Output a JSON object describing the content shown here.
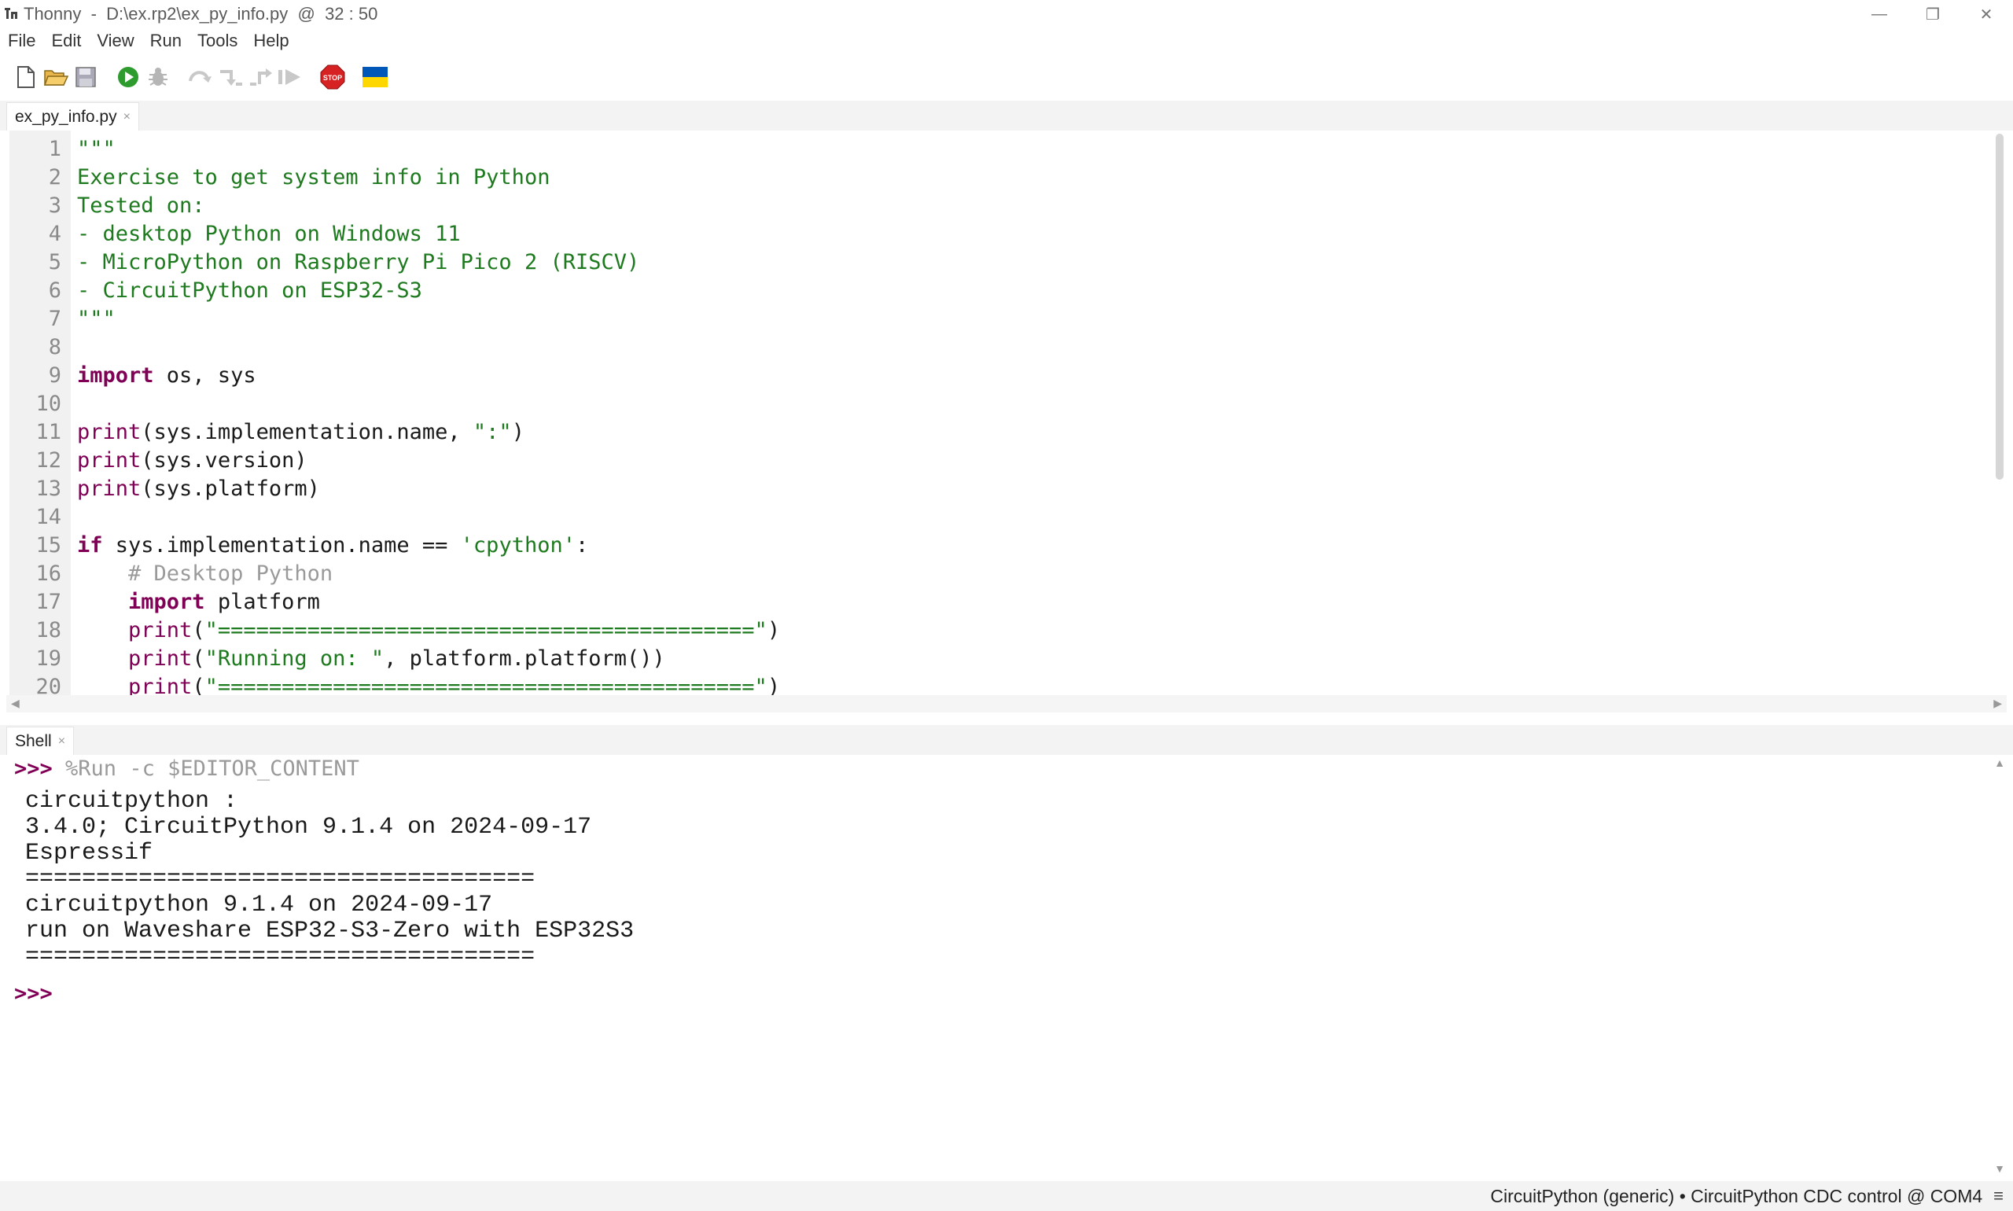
{
  "window": {
    "title": "Thonny  -  D:\\ex.rp2\\ex_py_info.py  @  32 : 50",
    "minimize": "—",
    "maximize": "❐",
    "close": "✕"
  },
  "menu": [
    "File",
    "Edit",
    "View",
    "Run",
    "Tools",
    "Help"
  ],
  "toolbar": {
    "icons": [
      "new-file-icon",
      "open-folder-icon",
      "save-icon",
      "run-icon",
      "debug-icon",
      "step-over-icon",
      "step-into-icon",
      "step-out-icon",
      "resume-icon",
      "stop-icon",
      "ukraine-flag-icon"
    ],
    "colors": {
      "run": "#2e9b2e",
      "stop": "#d62222",
      "flag_blue": "#0057b7",
      "flag_yellow": "#ffd700"
    }
  },
  "editor": {
    "tab_label": "ex_py_info.py",
    "tab_close": "×",
    "line_numbers": [
      "1",
      "2",
      "3",
      "4",
      "5",
      "6",
      "7",
      "8",
      "9",
      "10",
      "11",
      "12",
      "13",
      "14",
      "15",
      "16",
      "17",
      "18",
      "19",
      "20"
    ],
    "lines": [
      "\"\"\"",
      "Exercise to get system info in Python",
      "Tested on:",
      "- desktop Python on Windows 11",
      "- MicroPython on Raspberry Pi Pico 2 (RISCV)",
      "- CircuitPython on ESP32-S3",
      "\"\"\"",
      "",
      "import os, sys",
      "",
      "print(sys.implementation.name, \":\")",
      "print(sys.version)",
      "print(sys.platform)",
      "",
      "if sys.implementation.name == 'cpython':",
      "    # Desktop Python",
      "    import platform",
      "    print(\"==========================================\")",
      "    print(\"Running on: \", platform.platform())",
      "    print(\"==========================================\")"
    ]
  },
  "shell": {
    "tab_label": "Shell",
    "tab_close": "×",
    "prompt": ">>>",
    "command": " %Run -c $EDITOR_CONTENT",
    "output": [
      "circuitpython :",
      "3.4.0; CircuitPython 9.1.4 on 2024-09-17",
      "Espressif",
      "====================================",
      "circuitpython 9.1.4 on 2024-09-17",
      "run on Waveshare ESP32-S3-Zero with ESP32S3",
      "===================================="
    ],
    "final_prompt": ">>>"
  },
  "status": {
    "text": "CircuitPython (generic)  •  CircuitPython CDC control @ COM4",
    "menu_glyph": "≡"
  }
}
